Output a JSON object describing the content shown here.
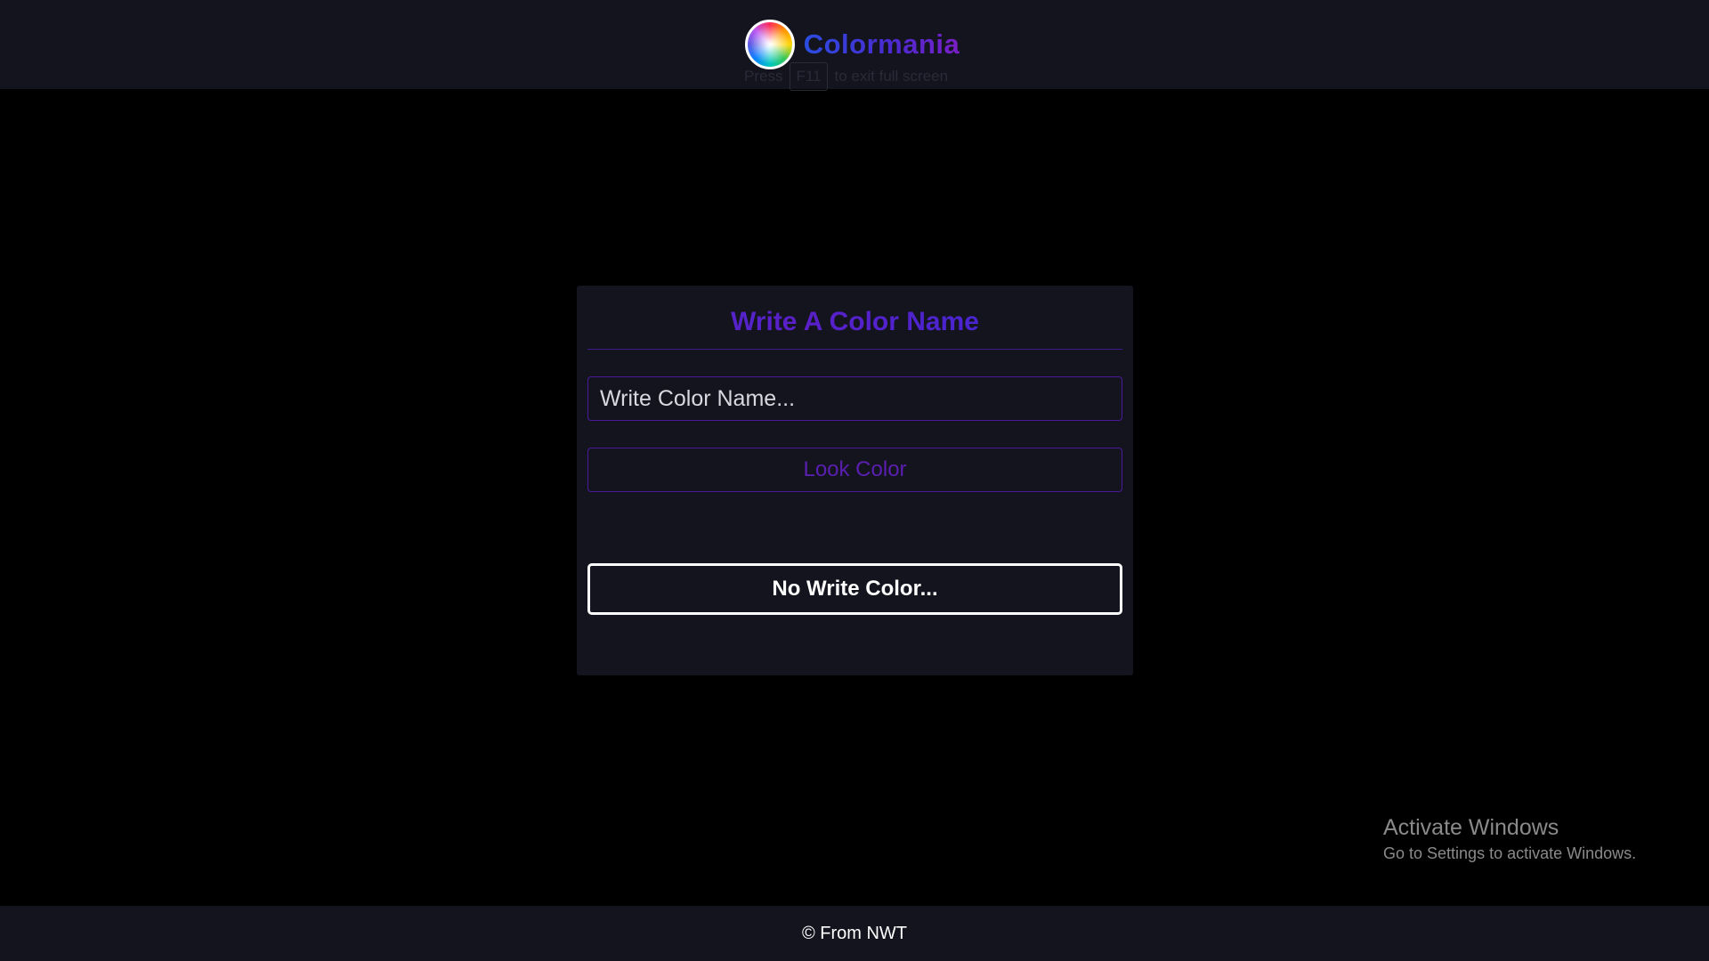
{
  "app": {
    "name": "Colormania",
    "logo_icon": "color-wheel-icon"
  },
  "fullscreen_hint": {
    "prefix": "Press",
    "key": "F11",
    "suffix": "to exit full screen"
  },
  "card": {
    "title": "Write A Color Name",
    "input_placeholder": "Write Color Name...",
    "input_value": "",
    "button_label": "Look Color",
    "result_text": "No Write Color..."
  },
  "watermark": {
    "title": "Activate Windows",
    "subtitle": "Go to Settings to activate Windows."
  },
  "footer": {
    "text": "© From NWT"
  },
  "colors": {
    "page_background": "#000000",
    "panel_background": "#14141f",
    "accent_blue": "#2b4de0",
    "accent_purple": "#4b1a9c",
    "text_white": "#ffffff"
  }
}
